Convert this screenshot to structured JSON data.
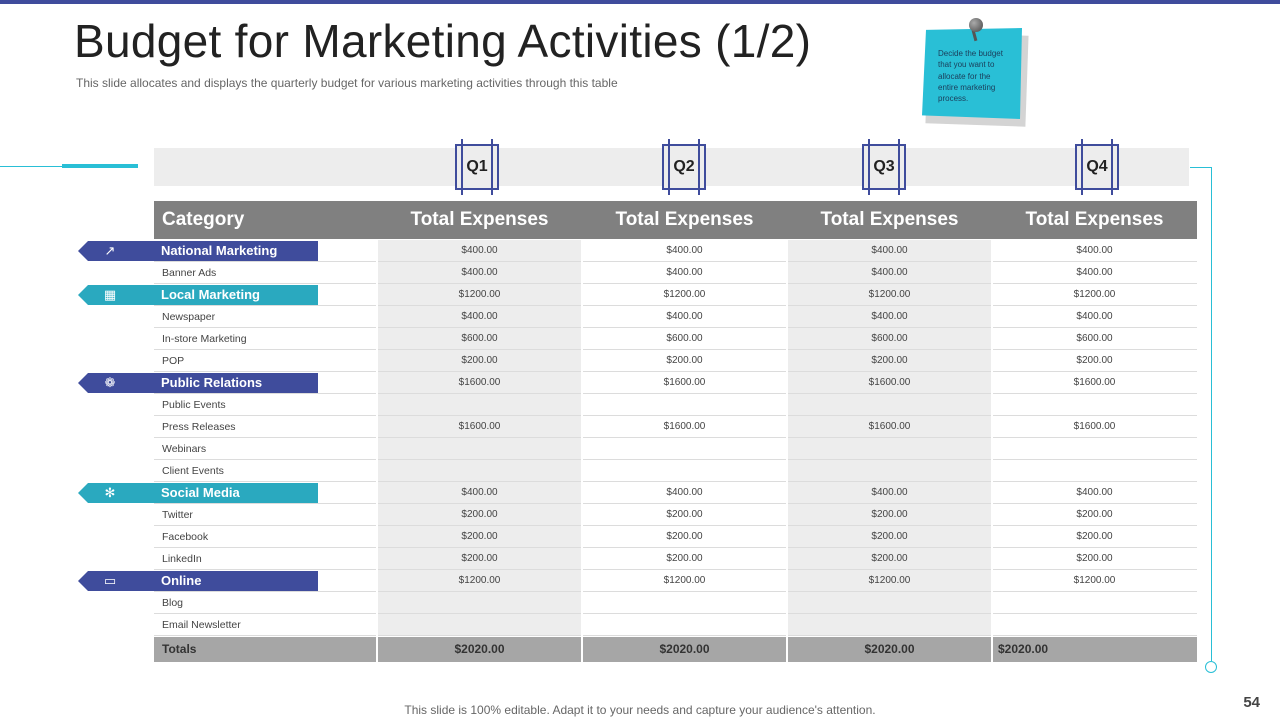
{
  "slide": {
    "title": "Budget for Marketing Activities (1/2)",
    "subtitle": "This slide allocates and displays the quarterly budget for various marketing activities through this table",
    "note": "Decide the budget that you want to allocate for the entire marketing process.",
    "footer": "This slide is 100% editable. Adapt it to your needs and capture your audience's attention.",
    "page_number": "54"
  },
  "colors": {
    "navy": "#3f4c9c",
    "teal": "#2aa9bf",
    "header_gray": "#808080",
    "totals_gray": "#a6a6a6"
  },
  "quarters": [
    "Q1",
    "Q2",
    "Q3",
    "Q4"
  ],
  "table": {
    "header": {
      "category": "Category",
      "columns": [
        "Total Expenses",
        "Total Expenses",
        "Total Expenses",
        "Total Expenses"
      ]
    },
    "rows": [
      {
        "label": "National Marketing",
        "section": true,
        "color": "navy",
        "icon": "chart-growth-icon",
        "values": [
          "$400.00",
          "$400.00",
          "$400.00",
          "$400.00"
        ]
      },
      {
        "label": "Banner Ads",
        "values": [
          "$400.00",
          "$400.00",
          "$400.00",
          "$400.00"
        ]
      },
      {
        "label": "Local Marketing",
        "section": true,
        "color": "teal",
        "icon": "building-icon",
        "values": [
          "$1200.00",
          "$1200.00",
          "$1200.00",
          "$1200.00"
        ]
      },
      {
        "label": "Newspaper",
        "values": [
          "$400.00",
          "$400.00",
          "$400.00",
          "$400.00"
        ]
      },
      {
        "label": "In-store Marketing",
        "values": [
          "$600.00",
          "$600.00",
          "$600.00",
          "$600.00"
        ]
      },
      {
        "label": "POP",
        "values": [
          "$200.00",
          "$200.00",
          "$200.00",
          "$200.00"
        ]
      },
      {
        "label": "Public Relations",
        "section": true,
        "color": "navy",
        "icon": "people-network-icon",
        "values": [
          "$1600.00",
          "$1600.00",
          "$1600.00",
          "$1600.00"
        ]
      },
      {
        "label": "Public Events",
        "values": [
          "",
          "",
          "",
          ""
        ]
      },
      {
        "label": "Press Releases",
        "values": [
          "$1600.00",
          "$1600.00",
          "$1600.00",
          "$1600.00"
        ]
      },
      {
        "label": "Webinars",
        "values": [
          "",
          "",
          "",
          ""
        ]
      },
      {
        "label": "Client Events",
        "values": [
          "",
          "",
          "",
          ""
        ]
      },
      {
        "label": "Social Media",
        "section": true,
        "color": "teal",
        "icon": "social-network-icon",
        "values": [
          "$400.00",
          "$400.00",
          "$400.00",
          "$400.00"
        ]
      },
      {
        "label": "Twitter",
        "values": [
          "$200.00",
          "$200.00",
          "$200.00",
          "$200.00"
        ]
      },
      {
        "label": "Facebook",
        "values": [
          "$200.00",
          "$200.00",
          "$200.00",
          "$200.00"
        ]
      },
      {
        "label": "LinkedIn",
        "values": [
          "$200.00",
          "$200.00",
          "$200.00",
          "$200.00"
        ]
      },
      {
        "label": "Online",
        "section": true,
        "color": "navy",
        "icon": "monitor-icon",
        "values": [
          "$1200.00",
          "$1200.00",
          "$1200.00",
          "$1200.00"
        ]
      },
      {
        "label": "Blog",
        "values": [
          "",
          "",
          "",
          ""
        ]
      },
      {
        "label": "Email Newsletter",
        "values": [
          "",
          "",
          "",
          ""
        ]
      }
    ],
    "totals": {
      "label": "Totals",
      "values": [
        "$2020.00",
        "$2020.00",
        "$2020.00",
        "$2020.00"
      ]
    }
  }
}
